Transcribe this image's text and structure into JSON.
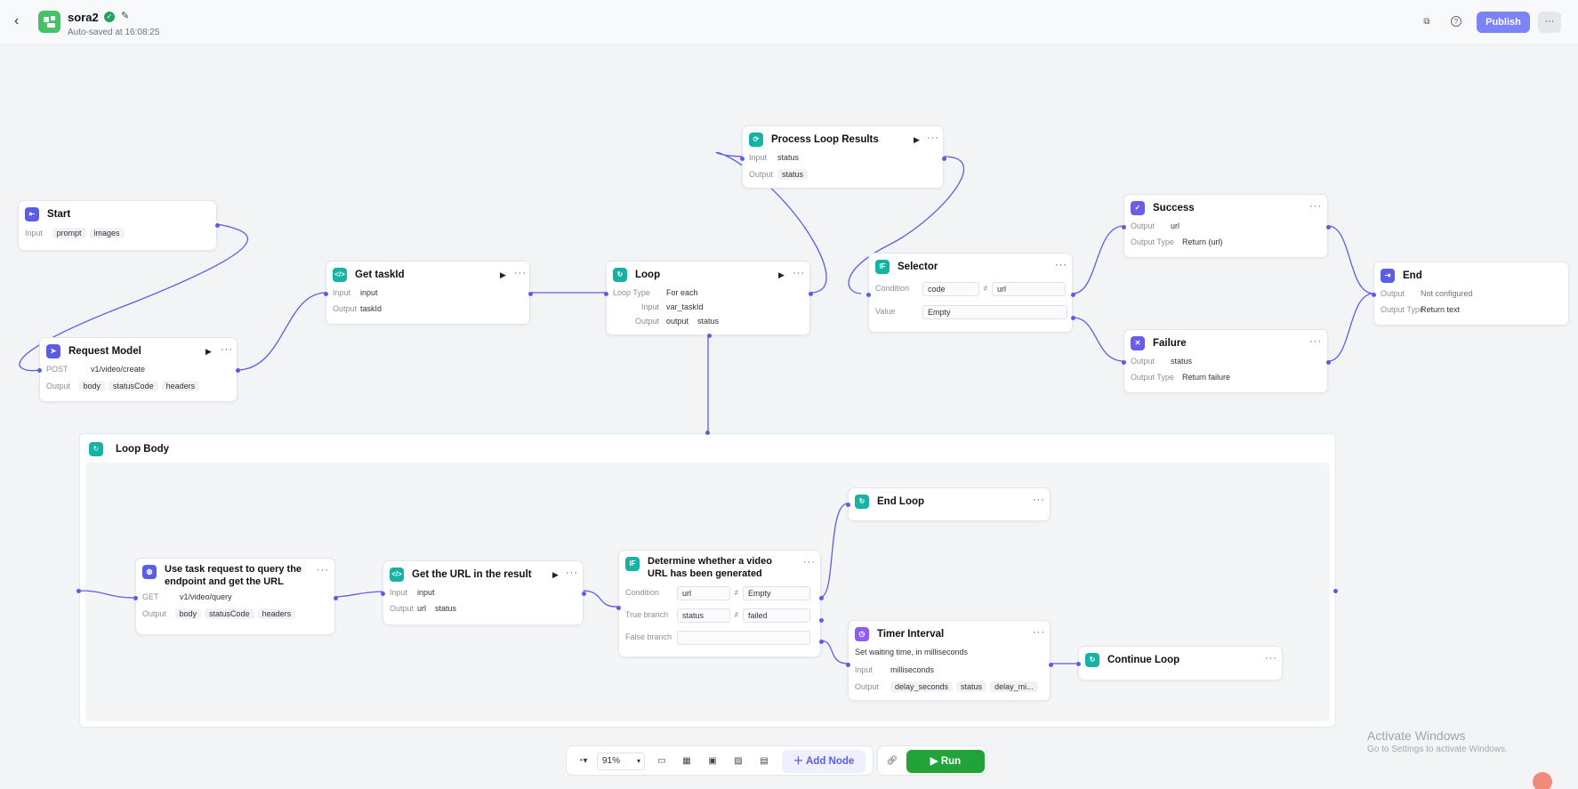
{
  "header": {
    "back_icon": "chevron-left-icon",
    "title": "sora2",
    "autosave": "Auto-saved at 16:08:25",
    "publish": "Publish",
    "more": "···"
  },
  "nodes": {
    "start": {
      "title": "Start",
      "input_label": "Input",
      "tags": [
        "prompt",
        "images"
      ]
    },
    "request": {
      "title": "Request Model",
      "method": "POST",
      "url": "v1/video/create",
      "output_label": "Output",
      "tags": [
        "body",
        "statusCode",
        "headers"
      ]
    },
    "gettask": {
      "title": "Get taskId",
      "input_label": "Input",
      "input_val": "input",
      "output_label": "Output",
      "output_val": "taskId"
    },
    "loop": {
      "title": "Loop",
      "type_label": "Loop Type",
      "type_val": "For each",
      "input_label": "Input",
      "input_val": "var_taskId",
      "output_label": "Output",
      "output_tags": [
        "output",
        "status"
      ]
    },
    "process": {
      "title": "Process Loop Results",
      "input_label": "Input",
      "input_val": "status",
      "output_label": "Output",
      "output_tag": "status"
    },
    "selector": {
      "title": "Selector",
      "icon_text": "IF",
      "cond_label": "Condition",
      "cond_left": "code",
      "cond_op": "≠",
      "cond_right": "url",
      "value_label": "Value",
      "value_val": "Empty"
    },
    "success": {
      "title": "Success",
      "output_label": "Output",
      "output_val": "url",
      "otype_label": "Output Type",
      "otype_val": "Return (url)"
    },
    "failure": {
      "title": "Failure",
      "output_label": "Output",
      "output_val": "status",
      "otype_label": "Output Type",
      "otype_val": "Return failure"
    },
    "end": {
      "title": "End",
      "output_label": "Output",
      "output_val": "Not configured",
      "otype_label": "Output Type",
      "otype_val": "Return text"
    },
    "usetask": {
      "title": "Use task request to query the endpoint and get the URL",
      "method": "GET",
      "url": "v1/video/query",
      "output_label": "Output",
      "tags": [
        "body",
        "statusCode",
        "headers"
      ]
    },
    "geturl": {
      "title": "Get the URL in the result",
      "input_label": "Input",
      "input_val": "input",
      "output_label": "Output",
      "output_tags": [
        "url",
        "status"
      ]
    },
    "determine": {
      "title": "Determine whether a video URL has been generated",
      "icon_text": "IF",
      "cond_label": "Condition",
      "cond_left": "url",
      "cond_op": "≠",
      "cond_right": "Empty",
      "true_label": "True branch",
      "true_left": "status",
      "true_op": "≠",
      "true_right": "failed",
      "false_label": "False branch"
    },
    "endloop": {
      "title": "End Loop"
    },
    "timer": {
      "title": "Timer Interval",
      "desc": "Set waiting time, in milliseconds",
      "input_label": "Input",
      "input_val": "milliseconds",
      "output_label": "Output",
      "output_tags": [
        "delay_seconds",
        "status",
        "delay_mi..."
      ]
    },
    "continue": {
      "title": "Continue Loop"
    }
  },
  "loopbody": {
    "title": "Loop Body"
  },
  "toolbar": {
    "zoom": "91%",
    "add_node": "Add Node",
    "run": "Run"
  },
  "watermark": {
    "title": "Activate Windows",
    "subtitle": "Go to Settings to activate Windows."
  },
  "colors": {
    "accent": "#5b5ee5",
    "publish": "#7c83f5",
    "run": "#22a33a",
    "teal": "#16b3a4"
  }
}
